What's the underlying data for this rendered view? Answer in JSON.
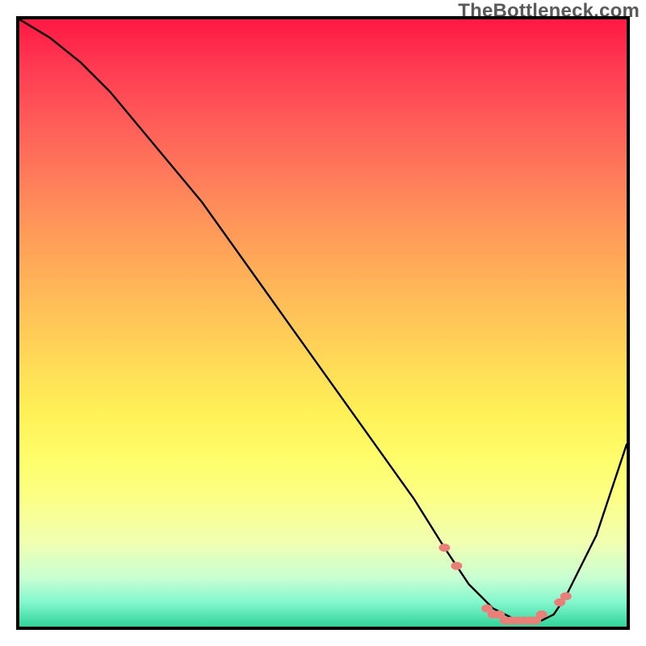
{
  "watermark_text": "TheBottleneck.com",
  "colors": {
    "border": "#000000",
    "curve": "#000000",
    "markers": "#eb7e76",
    "gradient_top": "#ff1844",
    "gradient_bottom": "#31d49b",
    "watermark": "#5a5a5a"
  },
  "chart_data": {
    "type": "line",
    "title": "",
    "xlabel": "",
    "ylabel": "",
    "xlim": [
      0,
      100
    ],
    "ylim": [
      0,
      100
    ],
    "grid": false,
    "legend": false,
    "series": [
      {
        "name": "bottleneck-curve",
        "x": [
          0,
          5,
          10,
          15,
          20,
          25,
          30,
          35,
          40,
          45,
          50,
          55,
          60,
          65,
          70,
          72,
          74,
          76,
          78,
          80,
          82,
          84,
          86,
          88,
          90,
          95,
          100
        ],
        "y": [
          100,
          97,
          93,
          88,
          82,
          76,
          70,
          63,
          56,
          49,
          42,
          35,
          28,
          21,
          13,
          10,
          7,
          5,
          3,
          2,
          1,
          1,
          1,
          2,
          5,
          15,
          30
        ]
      }
    ],
    "markers": {
      "name": "highlight-dots",
      "x": [
        70,
        72,
        77,
        78,
        79,
        80,
        81,
        82,
        83,
        84,
        85,
        86,
        89,
        90
      ],
      "y": [
        13,
        10,
        3,
        2,
        2,
        1,
        1,
        1,
        1,
        1,
        1,
        2,
        4,
        5
      ]
    }
  }
}
